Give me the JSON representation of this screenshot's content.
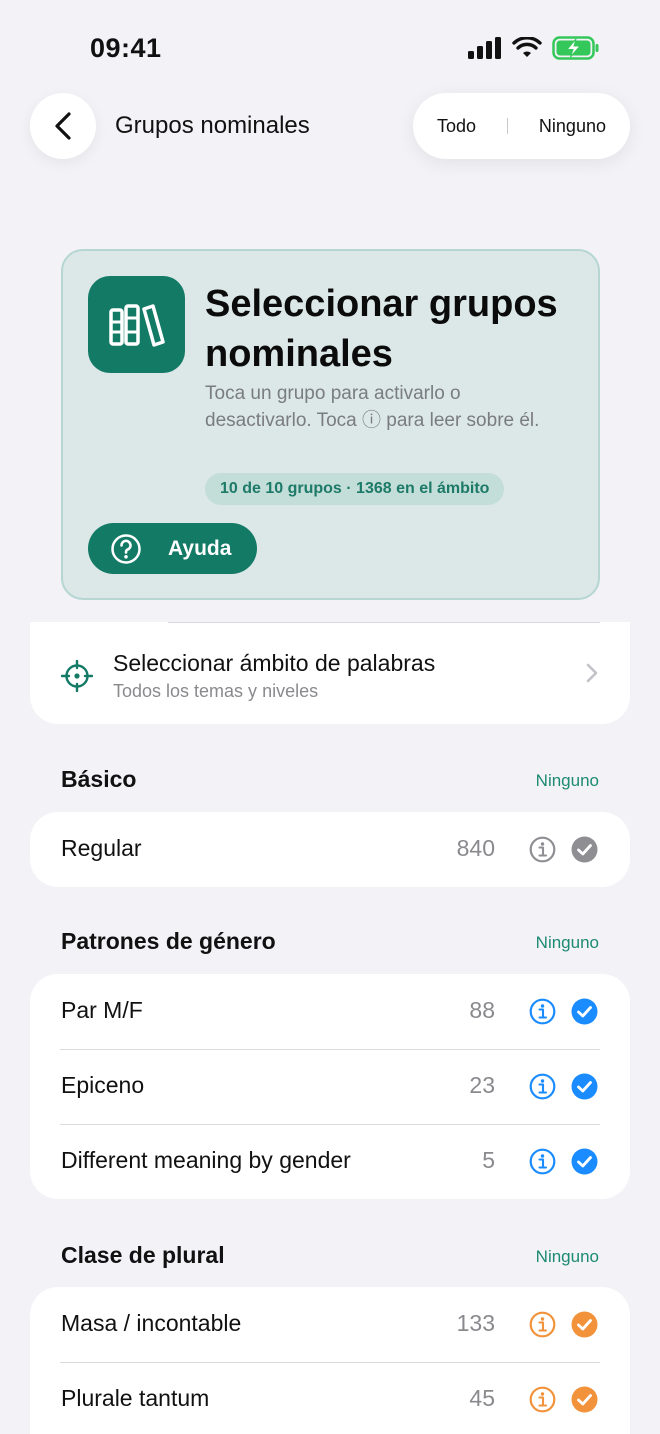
{
  "status_bar": {
    "time": "09:41"
  },
  "nav": {
    "title": "Grupos nominales",
    "select_all": "Todo",
    "select_none": "Ninguno"
  },
  "hero": {
    "title": "Seleccionar grupos nominales",
    "description": "Toca un grupo para activarlo o desactivarlo. Toca ⓘ para leer sobre él.",
    "badge": "10 de 10 grupos · 1368 en el ámbito",
    "help_label": "Ayuda"
  },
  "scope": {
    "title": "Seleccionar ámbito de palabras",
    "subtitle": "Todos los temas y niveles"
  },
  "colors": {
    "accent_green": "#137a66",
    "blue": "#1a8cff",
    "orange": "#f2923a",
    "gray_check": "#8e8e93"
  },
  "sections": [
    {
      "title": "Básico",
      "action": "Ninguno",
      "rows": [
        {
          "label": "Regular",
          "count": "840",
          "color": "gray",
          "checked": true
        }
      ]
    },
    {
      "title": "Patrones de género",
      "action": "Ninguno",
      "rows": [
        {
          "label": "Par M/F",
          "count": "88",
          "color": "blue",
          "checked": true
        },
        {
          "label": "Epiceno",
          "count": "23",
          "color": "blue",
          "checked": true
        },
        {
          "label": "Different meaning by gender",
          "count": "5",
          "color": "blue",
          "checked": true
        }
      ]
    },
    {
      "title": "Clase de plural",
      "action": "Ninguno",
      "rows": [
        {
          "label": "Masa / incontable",
          "count": "133",
          "color": "orange",
          "checked": true
        },
        {
          "label": "Plurale tantum",
          "count": "45",
          "color": "orange",
          "checked": true
        }
      ]
    }
  ]
}
